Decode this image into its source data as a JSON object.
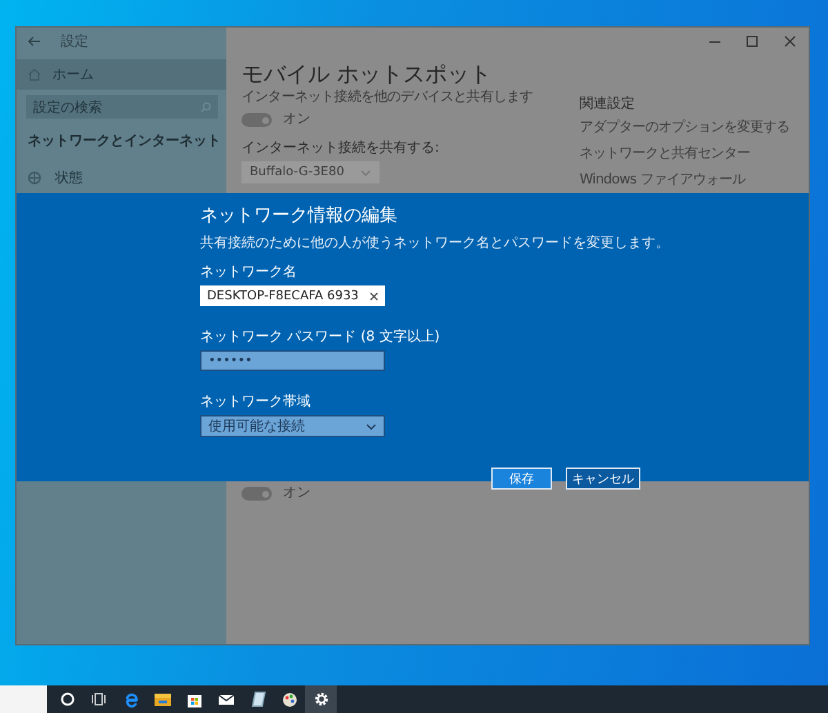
{
  "window": {
    "title": "設定"
  },
  "sidebar": {
    "items": [
      {
        "kind": "home",
        "label": "ホーム",
        "selected": true
      }
    ],
    "search": {
      "placeholder": "設定の検索"
    },
    "section": "ネットワークとインターネット",
    "nav": [
      {
        "kind": "status",
        "label": "状態",
        "selected": false
      }
    ]
  },
  "page": {
    "title": "モバイル ホットスポット",
    "description": "インターネット接続を他のデバイスと共有します",
    "toggle": {
      "on": true,
      "label": "オン"
    },
    "share_label": "インターネット接続を共有する:",
    "share_select": {
      "value": "Buffalo-G-3E80"
    },
    "toggle_2": {
      "on": true,
      "label": "オン"
    }
  },
  "related": {
    "heading": "関連設定",
    "links": [
      "アダプターのオプションを変更する",
      "ネットワークと共有センター",
      "Windows ファイアウォール"
    ]
  },
  "dialog": {
    "title": "ネットワーク情報の編集",
    "description": "共有接続のために他の人が使うネットワーク名とパスワードを変更します。",
    "fields": [
      {
        "kind": "text",
        "label": "ネットワーク名",
        "value": "DESKTOP-F8ECAFA 6933"
      },
      {
        "kind": "password",
        "label": "ネットワーク パスワード (8 文字以上)",
        "value": "••••••"
      },
      {
        "kind": "select",
        "label": "ネットワーク帯域",
        "value": "使用可能な接続"
      }
    ],
    "buttons": [
      {
        "label": "保存",
        "primary": true
      },
      {
        "label": "キャンセル",
        "primary": false
      }
    ]
  },
  "taskbar": {
    "apps": [
      {
        "kind": "cortana",
        "active": false
      },
      {
        "kind": "taskview",
        "active": false
      },
      {
        "kind": "browser",
        "active": false
      },
      {
        "kind": "folder",
        "active": false
      },
      {
        "kind": "store",
        "active": false
      },
      {
        "kind": "mail",
        "active": false
      },
      {
        "kind": "notepad",
        "active": false
      },
      {
        "kind": "paint",
        "active": false
      },
      {
        "kind": "settings",
        "active": true
      }
    ]
  }
}
